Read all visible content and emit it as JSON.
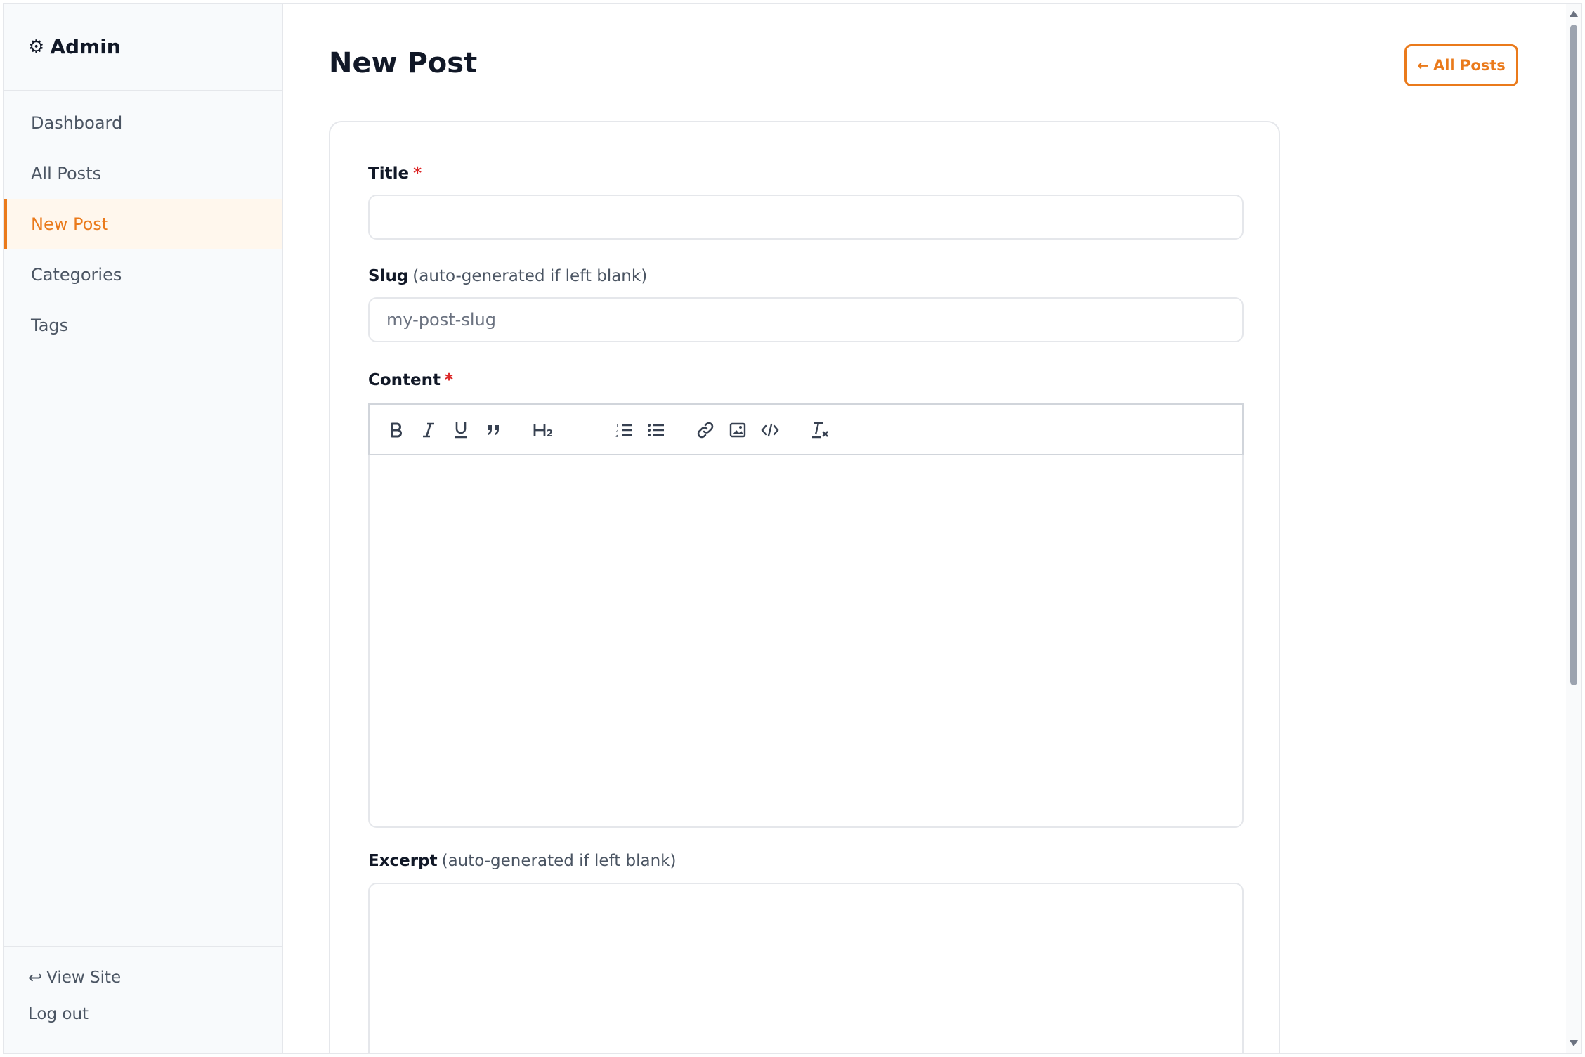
{
  "sidebar": {
    "brand": "Admin",
    "brand_icon": "⚙",
    "items": [
      {
        "label": "Dashboard"
      },
      {
        "label": "All Posts"
      },
      {
        "label": "New Post",
        "active": true
      },
      {
        "label": "Categories"
      },
      {
        "label": "Tags"
      }
    ],
    "footer": {
      "view_site_icon": "↩",
      "view_site": "View Site",
      "logout": "Log out"
    }
  },
  "header": {
    "title": "New Post",
    "back_button_icon": "←",
    "back_button": "All Posts"
  },
  "form": {
    "title_label": "Title",
    "required_mark": "*",
    "title_value": "",
    "slug_label": "Slug",
    "slug_hint": "(auto-generated if left blank)",
    "slug_placeholder": "my-post-slug",
    "content_label": "Content",
    "excerpt_label": "Excerpt",
    "excerpt_hint": "(auto-generated if left blank)"
  },
  "toolbar": {
    "buttons": [
      "bold-icon",
      "italic-icon",
      "underline-icon",
      "blockquote-icon",
      "heading2-icon",
      "ordered-list-icon",
      "bullet-list-icon",
      "link-icon",
      "image-icon",
      "code-icon",
      "clear-format-icon"
    ]
  },
  "colors": {
    "accent": "#ea7a1b",
    "required": "#dc2626",
    "sidebar_bg": "#f8fafc",
    "active_bg": "#fff7ed"
  }
}
